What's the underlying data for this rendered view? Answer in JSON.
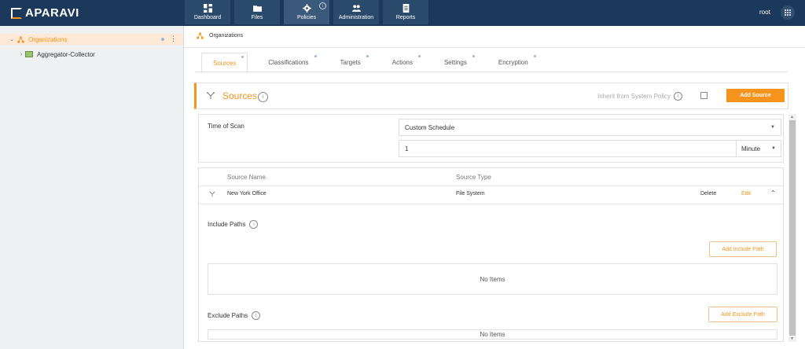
{
  "app": {
    "logo_text": "APARAVI"
  },
  "nav": {
    "items": [
      {
        "label": "Dashboard"
      },
      {
        "label": "Files"
      },
      {
        "label": "Policies"
      },
      {
        "label": "Administration"
      },
      {
        "label": "Reports"
      }
    ],
    "active": "Policies"
  },
  "user": {
    "name": "root"
  },
  "sidebar": {
    "root": {
      "label": "Organizations"
    },
    "child": {
      "label": "Aggregator-Collector"
    }
  },
  "breadcrumb": {
    "label": "Organizations"
  },
  "tabs": [
    {
      "label": "Sources"
    },
    {
      "label": "Classifications"
    },
    {
      "label": "Targets"
    },
    {
      "label": "Actions"
    },
    {
      "label": "Settings"
    },
    {
      "label": "Encryption"
    }
  ],
  "sources_header": {
    "title": "Sources",
    "inherit_label": "Inherit from System Policy",
    "add_button": "Add Source"
  },
  "schedule": {
    "label": "Time of Scan",
    "value": "Custom Schedule",
    "interval": "1",
    "unit": "Minute"
  },
  "table": {
    "headers": [
      "Source Name",
      "Source Type"
    ],
    "row": {
      "name": "New York Office",
      "type": "File System",
      "delete": "Delete",
      "edit": "Edit"
    }
  },
  "include": {
    "label": "Include Paths",
    "button": "Add Include Path",
    "empty": "No Items"
  },
  "exclude": {
    "label": "Exclude Paths",
    "button": "Add Exclude Path",
    "empty": "No Items"
  },
  "colors": {
    "accent": "#f7941d",
    "topbar": "#1b3a5b"
  }
}
